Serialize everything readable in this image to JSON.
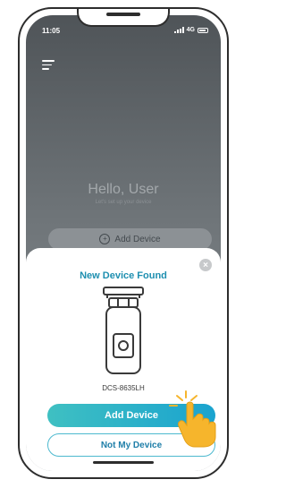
{
  "status": {
    "time": "11:05",
    "network": "4G"
  },
  "home": {
    "greeting": "Hello, User",
    "subtitle": "Let's set up your device",
    "add_device_label": "Add Device"
  },
  "dialog": {
    "title": "New Device Found",
    "device_model": "DCS-8635LH",
    "primary_button": "Add Device",
    "secondary_button": "Not My Device",
    "close_icon": "close-icon"
  },
  "colors": {
    "accent": "#1aa3cf",
    "title": "#1e8fb0",
    "hand": "#f6b52c"
  }
}
